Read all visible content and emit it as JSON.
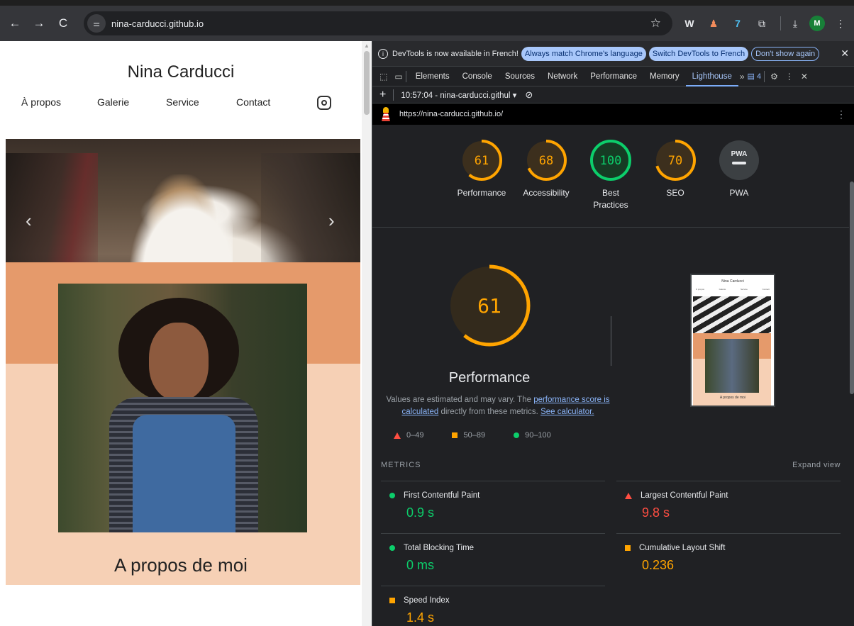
{
  "browser": {
    "url": "nina-carducci.github.io",
    "nav": {
      "back": "←",
      "forward": "→",
      "reload": "C"
    },
    "tune_icon": "⚌",
    "star": "☆",
    "extensions": [
      "W",
      "♟",
      "7",
      "⧉"
    ],
    "download": "⤓",
    "avatar": "M",
    "menu": "⋮"
  },
  "site": {
    "title": "Nina Carducci",
    "nav": [
      "À propos",
      "Galerie",
      "Service",
      "Contact"
    ],
    "prev": "‹",
    "next": "›",
    "about_title": "A propos de moi"
  },
  "devtools": {
    "infobar": {
      "message": "DevTools is now available in French!",
      "btn_match": "Always match Chrome's language",
      "btn_switch": "Switch DevTools to French",
      "btn_dismiss": "Don't show again",
      "close": "✕"
    },
    "tabs": [
      "Elements",
      "Console",
      "Sources",
      "Network",
      "Performance",
      "Memory",
      "Lighthouse"
    ],
    "active_tab": "Lighthouse",
    "more": "»",
    "issues_count": "4",
    "settings": "⚙",
    "kebab": "⋮",
    "close": "✕",
    "report_select": "10:57:04 - nina-carducci.githul ▾",
    "clear": "⊘",
    "report_url": "https://nina-carducci.github.io/"
  },
  "colors": {
    "fail": "#ff4e42",
    "average": "#ffa400",
    "pass": "#0cce6b",
    "accent": "#8ab4f8"
  },
  "scores": [
    {
      "label": "Performance",
      "score": "61",
      "value": 61,
      "rating": "average"
    },
    {
      "label": "Accessibility",
      "score": "68",
      "value": 68,
      "rating": "average"
    },
    {
      "label": "Best Practices",
      "score": "100",
      "value": 100,
      "rating": "pass"
    },
    {
      "label": "SEO",
      "score": "70",
      "value": 70,
      "rating": "average"
    },
    {
      "label": "PWA",
      "score": "PWA",
      "value": null,
      "rating": "na"
    }
  ],
  "performance": {
    "score": "61",
    "value": 61,
    "title": "Performance",
    "desc_1": "Values are estimated and may vary. The ",
    "link_1": "performance score is calculated",
    "desc_2": " directly from these metrics. ",
    "link_2": "See calculator.",
    "legend": [
      "0–49",
      "50–89",
      "90–100"
    ],
    "thumb_title": "Nina Carducci",
    "thumb_nav": [
      "À propos",
      "Galerie",
      "Service",
      "Contact"
    ],
    "thumb_caption": "A propos de moi"
  },
  "metrics": {
    "header": "METRICS",
    "expand": "Expand view",
    "items": [
      {
        "name": "First Contentful Paint",
        "value": "0.9 s",
        "rating": "pass"
      },
      {
        "name": "Largest Contentful Paint",
        "value": "9.8 s",
        "rating": "fail"
      },
      {
        "name": "Total Blocking Time",
        "value": "0 ms",
        "rating": "pass"
      },
      {
        "name": "Cumulative Layout Shift",
        "value": "0.236",
        "rating": "average"
      },
      {
        "name": "Speed Index",
        "value": "1.4 s",
        "rating": "average"
      }
    ]
  }
}
